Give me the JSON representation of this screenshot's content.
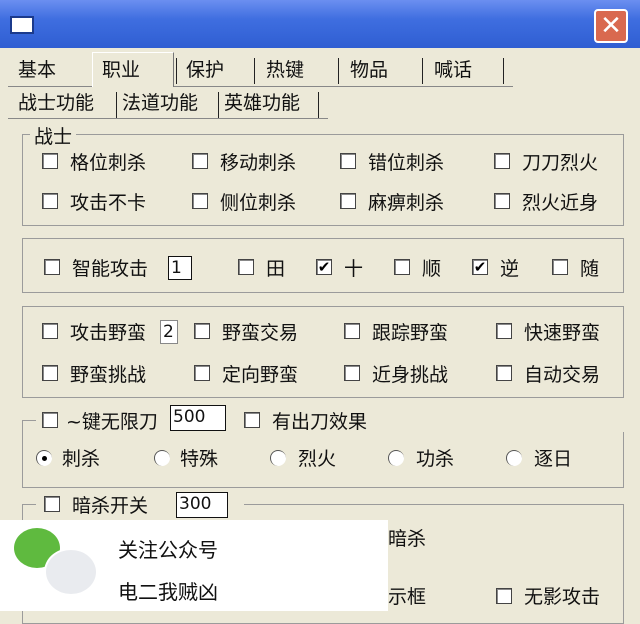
{
  "window": {
    "close_glyph": "✕",
    "icons": [
      "app-icon",
      "close-icon"
    ]
  },
  "tabs": [
    {
      "label": "基本",
      "active": false
    },
    {
      "label": "职业",
      "active": true
    },
    {
      "label": "保护",
      "active": false
    },
    {
      "label": "热键",
      "active": false
    },
    {
      "label": "物品",
      "active": false
    },
    {
      "label": "喊话",
      "active": false
    }
  ],
  "subtabs": [
    {
      "label": "战士功能",
      "active": true
    },
    {
      "label": "法道功能",
      "active": false
    },
    {
      "label": "英雄功能",
      "active": false
    }
  ],
  "warrior": {
    "legend": "战士",
    "row1": [
      {
        "label": "格位刺杀",
        "checked": false
      },
      {
        "label": "移动刺杀",
        "checked": false
      },
      {
        "label": "错位刺杀",
        "checked": false
      },
      {
        "label": "刀刀烈火",
        "checked": false
      }
    ],
    "row2": [
      {
        "label": "攻击不卡",
        "checked": false
      },
      {
        "label": "侧位刺杀",
        "checked": false
      },
      {
        "label": "麻痹刺杀",
        "checked": false
      },
      {
        "label": "烈火近身",
        "checked": false
      }
    ]
  },
  "smart": {
    "label": "智能攻击",
    "checked": false,
    "value": "1",
    "options": [
      {
        "label": "田",
        "checked": false
      },
      {
        "label": "十",
        "checked": true
      },
      {
        "label": "顺",
        "checked": false
      },
      {
        "label": "逆",
        "checked": true
      },
      {
        "label": "随",
        "checked": false
      }
    ]
  },
  "barbarian": {
    "row1": [
      {
        "label": "攻击野蛮",
        "checked": false
      },
      {
        "label": "野蛮交易",
        "checked": false
      },
      {
        "label": "跟踪野蛮",
        "checked": false
      },
      {
        "label": "快速野蛮",
        "checked": false
      }
    ],
    "row1_value": "2",
    "row2": [
      {
        "label": "野蛮挑战",
        "checked": false
      },
      {
        "label": "定向野蛮",
        "checked": false
      },
      {
        "label": "近身挑战",
        "checked": false
      },
      {
        "label": "自动交易",
        "checked": false
      }
    ]
  },
  "blade": {
    "label": "~键无限刀",
    "checked": false,
    "value": "500",
    "effect_label": "有出刀效果",
    "effect_checked": false,
    "radios": [
      {
        "label": "刺杀",
        "selected": true
      },
      {
        "label": "特殊",
        "selected": false
      },
      {
        "label": "烈火",
        "selected": false
      },
      {
        "label": "功杀",
        "selected": false
      },
      {
        "label": "逐日",
        "selected": false
      }
    ]
  },
  "assassin": {
    "label": "暗杀开关",
    "checked": false,
    "value": "300",
    "partial_label": "暗杀",
    "partial_label2": "示框",
    "shadow_label": "无影攻击",
    "shadow_checked": false
  },
  "watermark": {
    "line1": "关注公众号",
    "line2": "电二我贼凶",
    "icon": "wechat-icon"
  }
}
